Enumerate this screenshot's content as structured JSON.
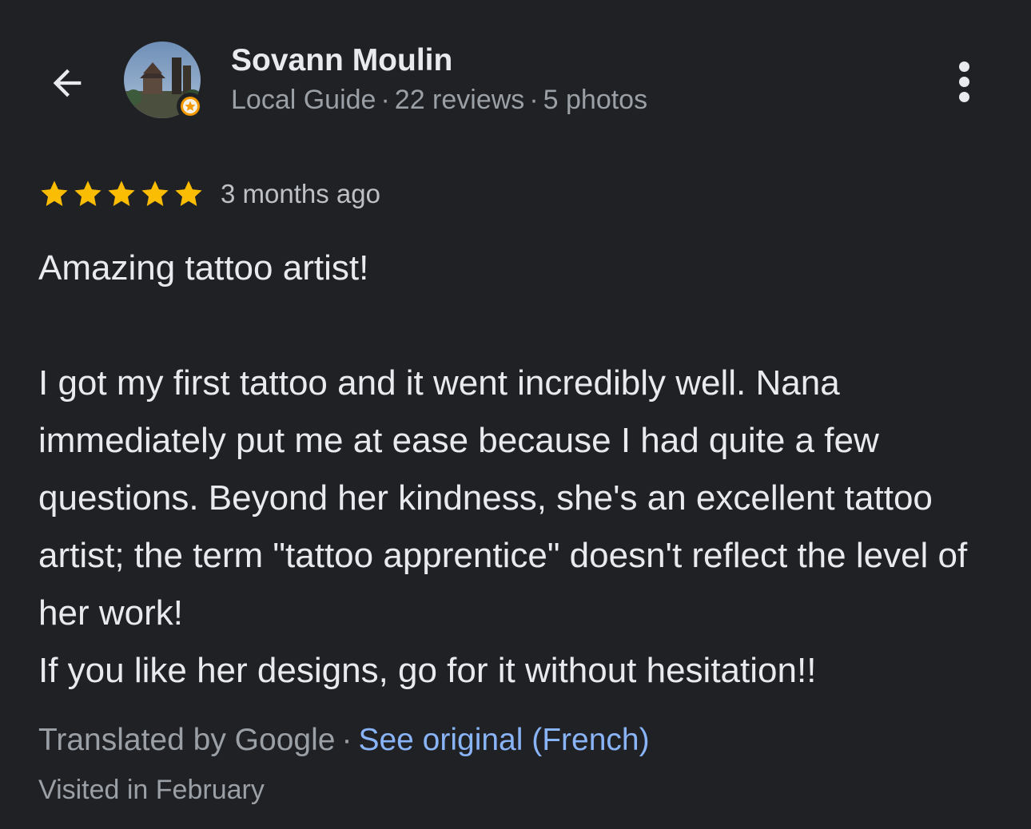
{
  "reviewer": {
    "name": "Sovann Moulin",
    "level": "Local Guide",
    "reviews_count": "22 reviews",
    "photos_count": "5 photos",
    "separator": "·"
  },
  "review": {
    "rating": 5,
    "max_rating": 5,
    "date": "3 months ago",
    "headline": "Amazing tattoo artist!",
    "paragraph1": "I got my first tattoo and it went incredibly well. Nana immediately put me at ease because I had quite a few questions. Beyond her kindness, she's an excellent tattoo artist; the term \"tattoo apprentice\" doesn't reflect the level of her work!",
    "paragraph2": "If you like her designs, go for it without hesitation!!"
  },
  "translation": {
    "translated_by": "Translated by Google",
    "separator": "·",
    "see_original": "See original (French)"
  },
  "visited": "Visited in February",
  "icons": {
    "back": "back-arrow-icon",
    "more": "more-vert-icon",
    "star": "star-icon",
    "badge": "local-guide-badge-icon"
  },
  "colors": {
    "background": "#202124",
    "star": "#fbbc04",
    "link": "#8ab4f8",
    "secondary_text": "#9aa0a6"
  }
}
